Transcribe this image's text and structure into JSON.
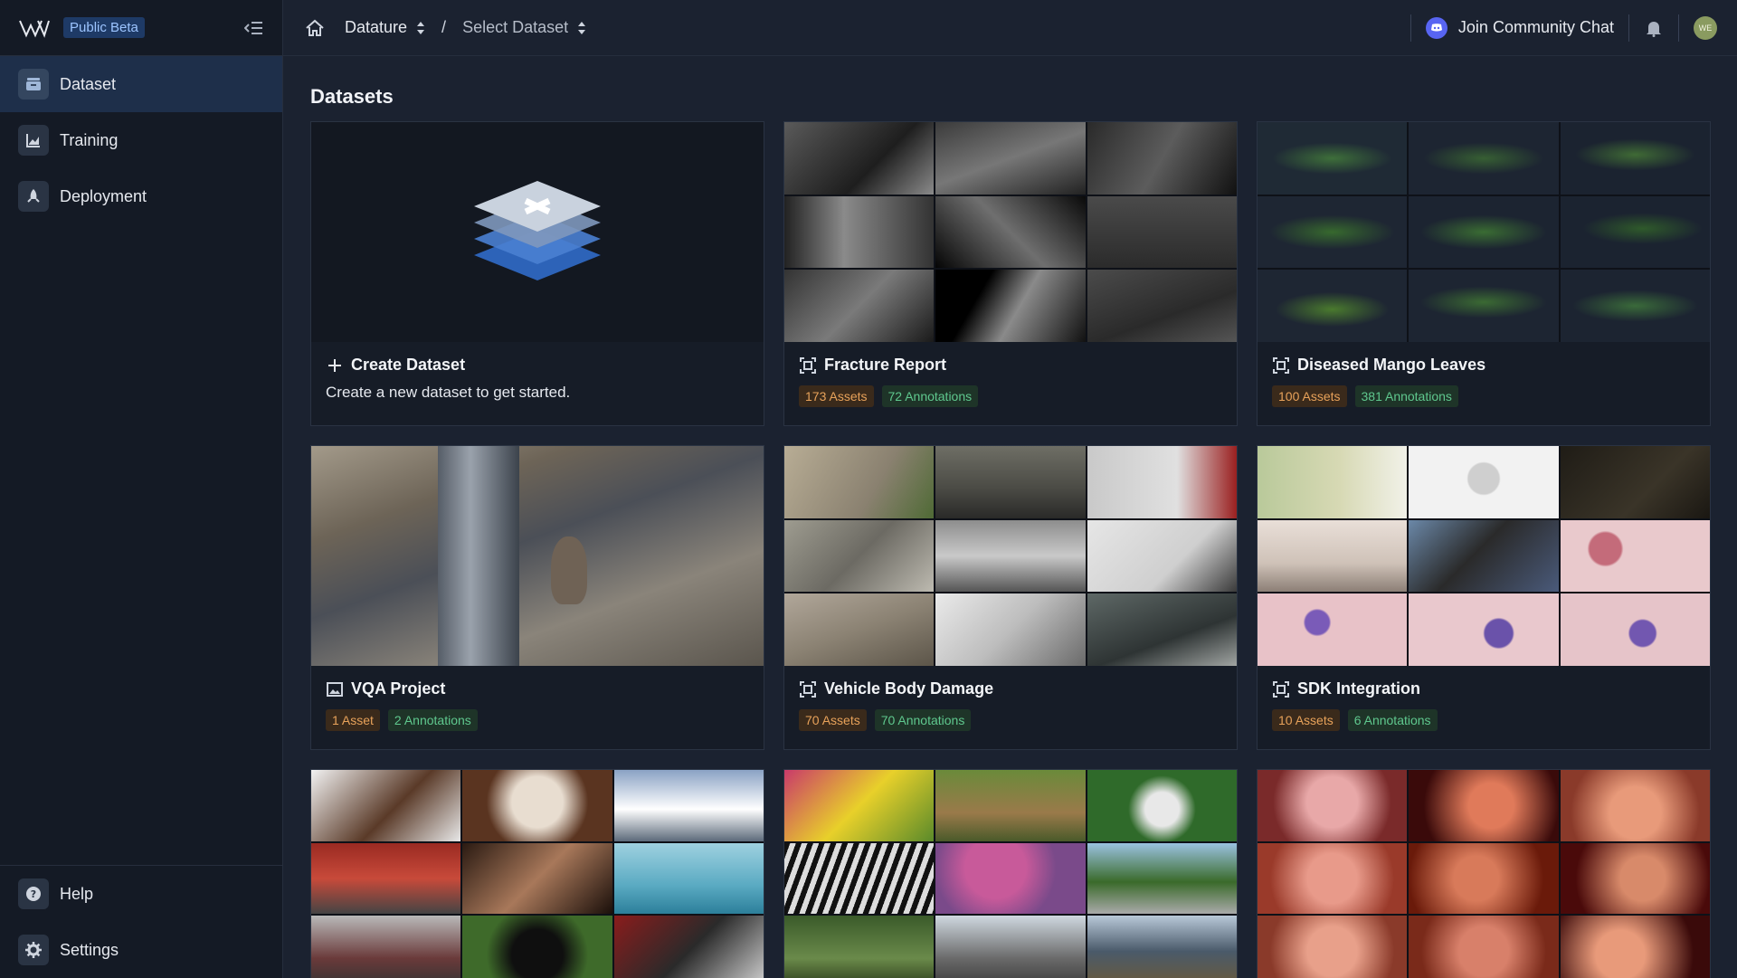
{
  "brand": {
    "badge": "Public Beta"
  },
  "sidebar": {
    "items": [
      {
        "label": "Dataset",
        "icon": "database-icon",
        "active": true
      },
      {
        "label": "Training",
        "icon": "chart-icon",
        "active": false
      },
      {
        "label": "Deployment",
        "icon": "rocket-icon",
        "active": false
      }
    ],
    "bottom": [
      {
        "label": "Help",
        "icon": "help-icon"
      },
      {
        "label": "Settings",
        "icon": "gear-icon"
      }
    ]
  },
  "topbar": {
    "project": "Datature",
    "separator": "/",
    "dataset": "Select Dataset",
    "community": "Join Community Chat",
    "avatar_initials": "WE"
  },
  "main": {
    "title": "Datasets",
    "create": {
      "title": "Create Dataset",
      "description": "Create a new dataset to get started."
    },
    "datasets": [
      {
        "title": "Fracture Report",
        "assets": "173 Assets",
        "annotations": "72 Annotations",
        "icon": "detection-icon"
      },
      {
        "title": "Diseased Mango Leaves",
        "assets": "100 Assets",
        "annotations": "381 Annotations",
        "icon": "detection-icon"
      },
      {
        "title": "VQA Project",
        "assets": "1 Asset",
        "annotations": "2 Annotations",
        "icon": "image-icon"
      },
      {
        "title": "Vehicle Body Damage",
        "assets": "70 Assets",
        "annotations": "70 Annotations",
        "icon": "detection-icon"
      },
      {
        "title": "SDK Integration",
        "assets": "10 Assets",
        "annotations": "6 Annotations",
        "icon": "detection-icon"
      }
    ]
  },
  "colors": {
    "accent": "#1e3a66",
    "assets_badge": "#e8a25a",
    "annotations_badge": "#5fc88e"
  }
}
